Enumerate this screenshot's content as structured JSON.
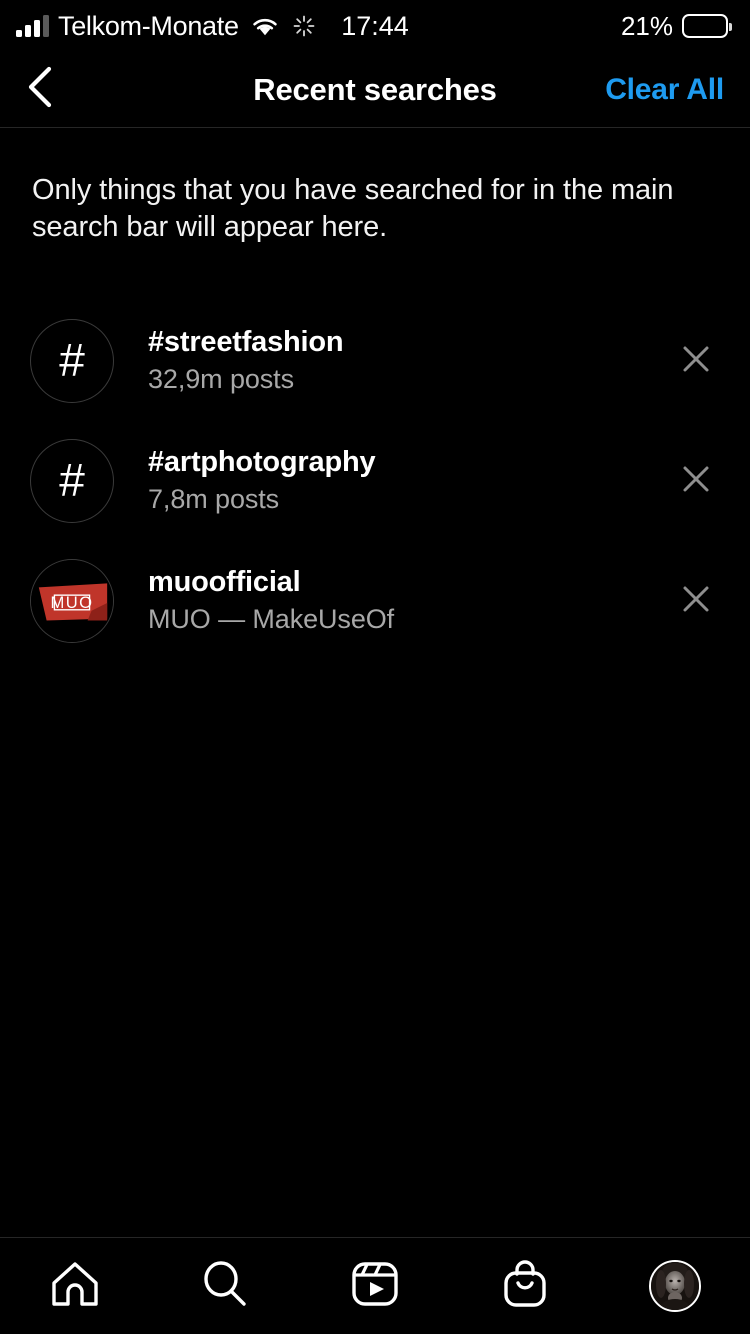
{
  "status_bar": {
    "carrier": "Telkom-Monate",
    "time": "17:44",
    "battery_percent": "21%",
    "battery_level": 21,
    "signal_icon": "signal-bars-icon",
    "wifi_icon": "wifi-icon",
    "sync_icon": "sync-spinner-icon"
  },
  "header": {
    "back_icon": "chevron-left-icon",
    "title": "Recent searches",
    "clear_all_label": "Clear All",
    "accent_color": "#1E9BF0"
  },
  "main": {
    "description": "Only things that you have searched for in the main search bar will appear here.",
    "recent_searches": [
      {
        "avatar_type": "hashtag",
        "avatar_glyph": "#",
        "title": "#streetfashion",
        "subtitle": "32,9m posts",
        "remove_icon": "close-x-icon"
      },
      {
        "avatar_type": "hashtag",
        "avatar_glyph": "#",
        "title": "#artphotography",
        "subtitle": "7,8m posts",
        "remove_icon": "close-x-icon"
      },
      {
        "avatar_type": "photo",
        "avatar_glyph": "MUO",
        "avatar_color": "#C0352A",
        "title": "muoofficial",
        "subtitle": "MUO — MakeUseOf",
        "remove_icon": "close-x-icon"
      }
    ]
  },
  "tab_bar": {
    "items": [
      {
        "icon": "home-icon",
        "label": "Home"
      },
      {
        "icon": "search-icon",
        "label": "Search"
      },
      {
        "icon": "reels-icon",
        "label": "Reels"
      },
      {
        "icon": "shop-bag-icon",
        "label": "Shop"
      },
      {
        "icon": "profile-avatar-icon",
        "label": "Profile"
      }
    ]
  },
  "theme": {
    "background": "#000000",
    "text_primary": "#FFFFFF",
    "text_secondary": "#A8A8A8",
    "divider": "#262626"
  }
}
